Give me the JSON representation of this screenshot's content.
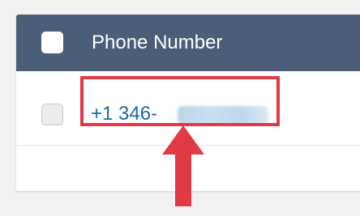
{
  "table": {
    "header": {
      "column_label": "Phone Number"
    },
    "rows": [
      {
        "phone_visible": "+1 346-"
      }
    ]
  },
  "colors": {
    "header_bg": "#4c5e77",
    "link": "#1a6aa8",
    "highlight": "#e23a45",
    "page_bg": "#f1f1f1"
  },
  "icons": {
    "annotation": "up-arrow-icon"
  }
}
